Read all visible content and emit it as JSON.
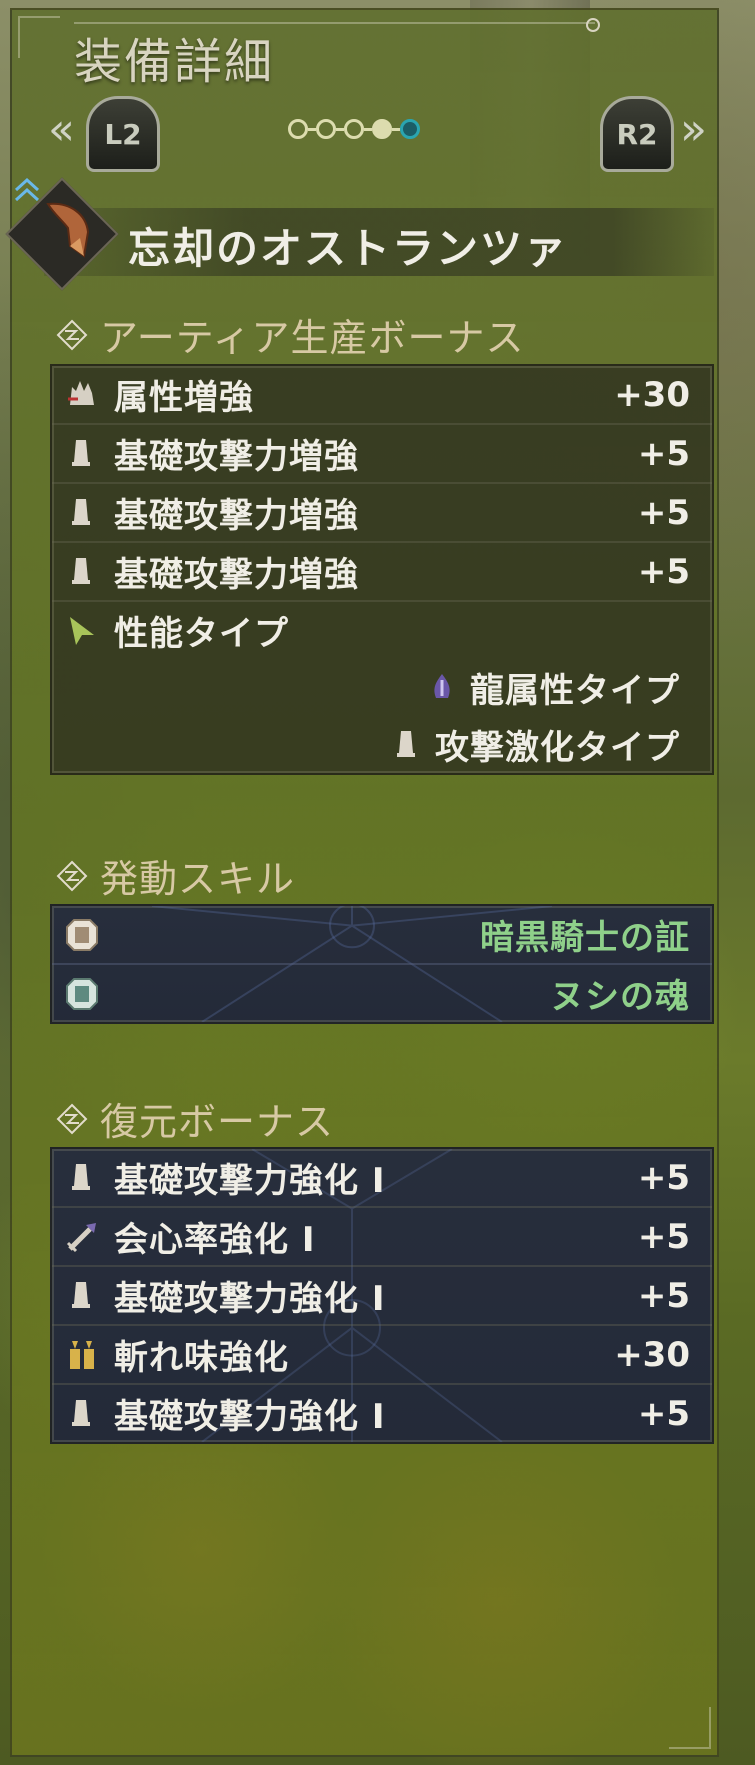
{
  "header": {
    "title": "装備詳細",
    "left_trigger": "L2",
    "right_trigger": "R2",
    "left_chevron": "«",
    "right_chevron": "»",
    "pages_total": 5,
    "page_current": 5
  },
  "weapon": {
    "name": "忘却のオストランツァ"
  },
  "artian_bonus": {
    "heading": "アーティア生産ボーナス",
    "items": [
      {
        "label": "属性増強",
        "value": "+30",
        "icon": "element-boost-icon"
      },
      {
        "label": "基礎攻撃力増強",
        "value": "+5",
        "icon": "attack-boost-icon"
      },
      {
        "label": "基礎攻撃力増強",
        "value": "+5",
        "icon": "attack-boost-icon"
      },
      {
        "label": "基礎攻撃力増強",
        "value": "+5",
        "icon": "attack-boost-icon"
      }
    ],
    "type_label": "性能タイプ",
    "types": [
      {
        "label": "龍属性タイプ",
        "icon": "dragon-element-icon"
      },
      {
        "label": "攻撃激化タイプ",
        "icon": "attack-boost-icon"
      }
    ]
  },
  "active_skills": {
    "heading": "発動スキル",
    "items": [
      {
        "label": "暗黒騎士の証",
        "icon": "set-skill-icon"
      },
      {
        "label": "ヌシの魂",
        "icon": "set-skill-icon"
      }
    ]
  },
  "restore_bonus": {
    "heading": "復元ボーナス",
    "items": [
      {
        "label": "基礎攻撃力強化 I",
        "value": "+5",
        "icon": "attack-boost-icon"
      },
      {
        "label": "会心率強化 I",
        "value": "+5",
        "icon": "affinity-icon"
      },
      {
        "label": "基礎攻撃力強化 I",
        "value": "+5",
        "icon": "attack-boost-icon"
      },
      {
        "label": "斬れ味強化",
        "value": "+30",
        "icon": "sharpness-icon"
      },
      {
        "label": "基礎攻撃力強化 I",
        "value": "+5",
        "icon": "attack-boost-icon"
      }
    ]
  },
  "colors": {
    "heading_text": "#d7c9a4",
    "skill_text": "#8fd08a",
    "pager_active": "#2aa5b0"
  }
}
